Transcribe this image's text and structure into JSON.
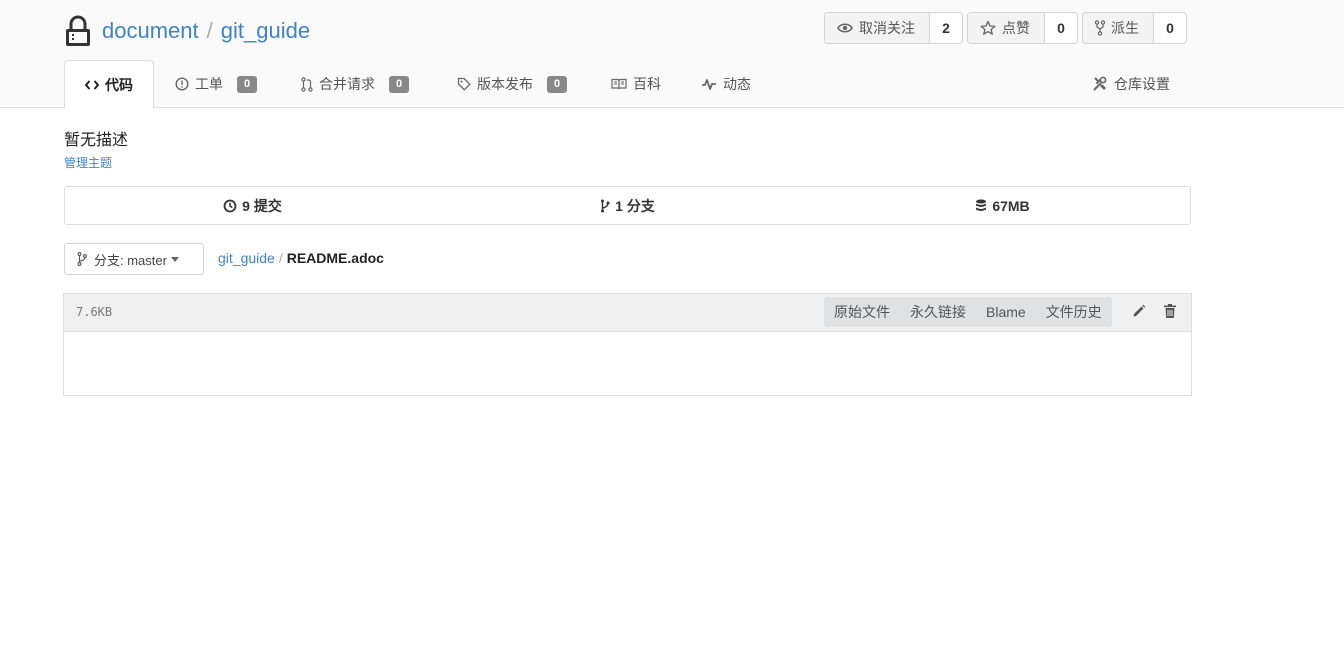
{
  "repo": {
    "owner": "document",
    "separator": "/",
    "name": "git_guide"
  },
  "header_buttons": [
    {
      "label": "取消关注",
      "count": "2",
      "icon": "eye-icon"
    },
    {
      "label": "点赞",
      "count": "0",
      "icon": "star-icon"
    },
    {
      "label": "派生",
      "count": "0",
      "icon": "fork-icon"
    }
  ],
  "tabs": [
    {
      "label": "代码",
      "icon": "code-icon",
      "active": true
    },
    {
      "label": "工单",
      "badge": "0",
      "icon": "issue-icon"
    },
    {
      "label": "合并请求",
      "badge": "0",
      "icon": "pull-request-icon"
    },
    {
      "label": "版本发布",
      "badge": "0",
      "icon": "tag-icon"
    },
    {
      "label": "百科",
      "icon": "book-icon"
    },
    {
      "label": "动态",
      "icon": "pulse-icon"
    }
  ],
  "settings_tab": {
    "label": "仓库设置",
    "icon": "tools-icon"
  },
  "description": "暂无描述",
  "manage_topics": "管理主题",
  "stats": {
    "commits": "9 提交",
    "branches": "1 分支",
    "size": "67MB"
  },
  "branch": {
    "label": "分支: master"
  },
  "breadcrumb": {
    "repo": "git_guide",
    "separator": "/",
    "file": "README.adoc"
  },
  "file": {
    "size": "7.6KB",
    "actions": {
      "raw": "原始文件",
      "permalink": "永久链接",
      "blame": "Blame",
      "history": "文件历史"
    },
    "tools": [
      "pencil-icon",
      "trash-icon"
    ]
  },
  "colors": {
    "link": "#4183c4",
    "badge": "#888888",
    "header_bg": "#fafafa"
  }
}
